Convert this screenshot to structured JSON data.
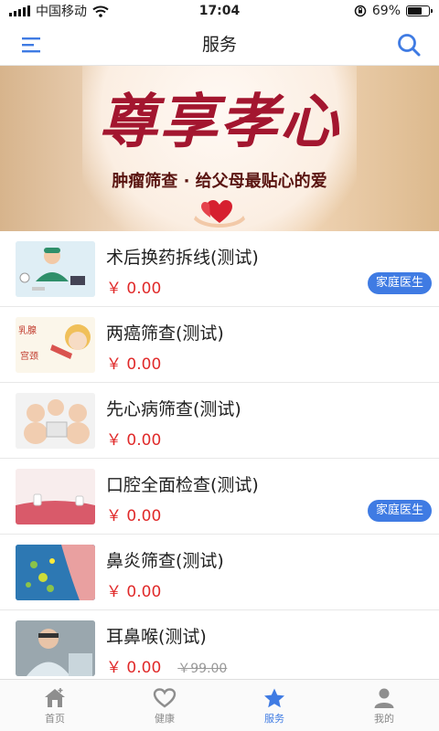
{
  "status": {
    "carrier": "中国移动",
    "time": "17:04",
    "battery": "69%",
    "battery_level": 0.69
  },
  "header": {
    "title": "服务",
    "menu_icon": "menu-icon",
    "search_icon": "search-icon"
  },
  "banner": {
    "title": "尊享孝心",
    "subtitle": "肿瘤筛查 · 给父母最贴心的爱"
  },
  "services": [
    {
      "name": "术后换药拆线(测试)",
      "price": "￥ 0.00",
      "tag": "家庭医生",
      "original_price": ""
    },
    {
      "name": "两癌筛查(测试)",
      "price": "￥ 0.00",
      "tag": "",
      "original_price": ""
    },
    {
      "name": "先心病筛查(测试)",
      "price": "￥ 0.00",
      "tag": "",
      "original_price": ""
    },
    {
      "name": "口腔全面检查(测试)",
      "price": "￥ 0.00",
      "tag": "家庭医生",
      "original_price": ""
    },
    {
      "name": "鼻炎筛查(测试)",
      "price": "￥ 0.00",
      "tag": "",
      "original_price": ""
    },
    {
      "name": "耳鼻喉(测试)",
      "price": "￥ 0.00",
      "tag": "",
      "original_price": "￥99.00"
    }
  ],
  "thumb_text": {
    "breast": "乳腺",
    "cervix": "宫颈"
  },
  "tabs": [
    {
      "label": "首页",
      "icon": "home-icon",
      "active": false
    },
    {
      "label": "健康",
      "icon": "heart-icon",
      "active": false
    },
    {
      "label": "服务",
      "icon": "star-icon",
      "active": true
    },
    {
      "label": "我的",
      "icon": "user-icon",
      "active": false
    }
  ],
  "colors": {
    "accent": "#3f7be3",
    "price": "#e02a2a",
    "banner_title": "#a3162f"
  }
}
